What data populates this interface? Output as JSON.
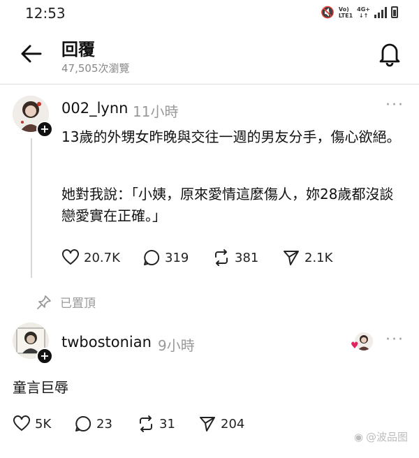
{
  "status_bar": {
    "time": "12:53",
    "net_top": "Vo)",
    "net_bottom": "LTE1",
    "net_gen": "4G+"
  },
  "header": {
    "title": "回覆",
    "views": "47,505次瀏覽"
  },
  "post": {
    "username": "002_lynn",
    "time": "11小時",
    "paragraph1": "13歲的外甥女昨晚與交往一週的男友分手，傷心欲絕。",
    "paragraph2": "她對我說：「小姨，原來愛情這麼傷人，妳28歲都沒談戀愛實在正確。」",
    "likes": "20.7K",
    "comments": "319",
    "reposts": "381",
    "shares": "2.1K"
  },
  "pinned_label": "已置頂",
  "reply": {
    "username": "twbostonian",
    "time": "9小時",
    "text": "童言巨辱",
    "likes": "5K",
    "comments": "23",
    "reposts": "31",
    "shares": "204"
  },
  "watermark": "@波品图",
  "icons": {
    "back": "arrow-left-icon",
    "bell": "bell-icon",
    "more": "more-dots-icon",
    "like": "heart-icon",
    "comment": "comment-bubble-icon",
    "repost": "repost-icon",
    "share": "send-icon",
    "pin": "pin-icon"
  }
}
